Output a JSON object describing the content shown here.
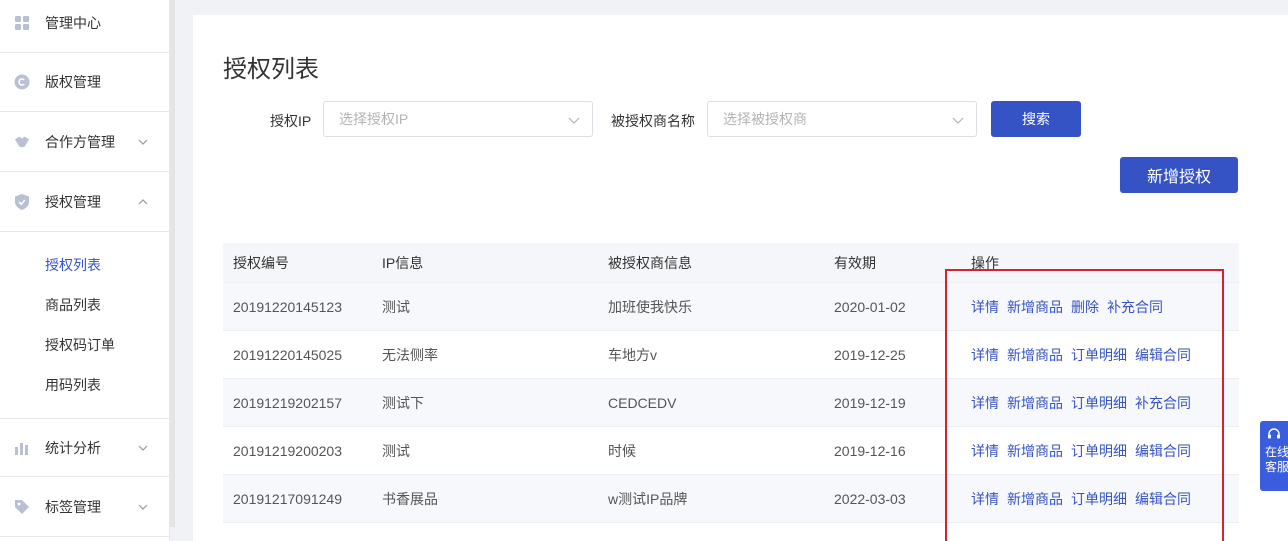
{
  "sidebar": {
    "items": [
      {
        "label": "管理中心",
        "icon": "dashboard-icon"
      },
      {
        "label": "版权管理",
        "icon": "copyright-icon"
      },
      {
        "label": "合作方管理",
        "icon": "handshake-icon",
        "expanded": false
      },
      {
        "label": "授权管理",
        "icon": "shield-icon",
        "expanded": true
      },
      {
        "label": "统计分析",
        "icon": "bar-chart-icon",
        "expanded": false
      },
      {
        "label": "标签管理",
        "icon": "tag-icon",
        "expanded": false
      }
    ],
    "subitems": [
      {
        "label": "授权列表",
        "active": true
      },
      {
        "label": "商品列表"
      },
      {
        "label": "授权码订单"
      },
      {
        "label": "用码列表"
      }
    ]
  },
  "page": {
    "title": "授权列表"
  },
  "filters": {
    "ip_label": "授权IP",
    "ip_placeholder": "选择授权IP",
    "licensee_label": "被授权商名称",
    "licensee_placeholder": "选择被授权商",
    "search_button": "搜索",
    "add_button": "新增授权"
  },
  "table": {
    "headers": [
      "授权编号",
      "IP信息",
      "被授权商信息",
      "有效期",
      "操作"
    ],
    "rows": [
      {
        "id": "20191220145123",
        "ip": "测试",
        "licensee": "加班使我快乐",
        "valid": "2020-01-02",
        "ops": [
          "详情",
          "新增商品",
          "删除",
          "补充合同"
        ]
      },
      {
        "id": "20191220145025",
        "ip": "无法侧率",
        "licensee": "车地方v",
        "valid": "2019-12-25",
        "ops": [
          "详情",
          "新增商品",
          "订单明细",
          "编辑合同"
        ]
      },
      {
        "id": "20191219202157",
        "ip": "测试下",
        "licensee": "CEDCEDV",
        "valid": "2019-12-19",
        "ops": [
          "详情",
          "新增商品",
          "订单明细",
          "补充合同"
        ]
      },
      {
        "id": "20191219200203",
        "ip": "测试",
        "licensee": "时候",
        "valid": "2019-12-16",
        "ops": [
          "详情",
          "新增商品",
          "订单明细",
          "编辑合同"
        ]
      },
      {
        "id": "20191217091249",
        "ip": "书香展品",
        "licensee": "w测试IP品牌",
        "valid": "2022-03-03",
        "ops": [
          "详情",
          "新增商品",
          "订单明细",
          "编辑合同"
        ]
      }
    ]
  },
  "service": {
    "line1": "在线",
    "line2": "客服",
    "icon": "headset-icon"
  },
  "colors": {
    "primary": "#3653c5",
    "highlight": "#d4232f",
    "active_menu": "#3355cc"
  }
}
